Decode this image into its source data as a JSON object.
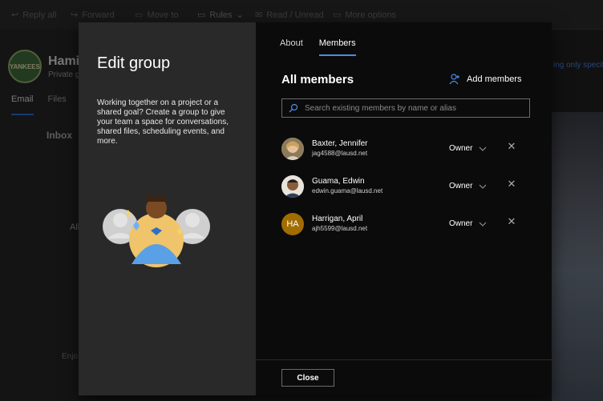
{
  "background": {
    "toolbar": {
      "reply_all": "Reply all",
      "forward": "Forward",
      "move_to": "Move to",
      "rules": "Rules",
      "read_unread": "Read / Unread",
      "more": "More options"
    },
    "group_logo_text": "YANKEES",
    "group_title": "Hamil",
    "group_sub": "Private g",
    "tab_email": "Email",
    "tab_files": "Files",
    "inbox": "Inbox",
    "all": "All",
    "enjoy": "Enjo",
    "right_text": "ing only specif"
  },
  "dialog": {
    "title": "Edit group",
    "description": "Working together on a project or a shared goal? Create a group to give your team a space for conversations, shared files, scheduling events, and more.",
    "tabs": [
      {
        "label": "About"
      },
      {
        "label": "Members"
      }
    ],
    "section_title": "All members",
    "add_members_label": "Add members",
    "search_placeholder": "Search existing members by name or alias",
    "members": [
      {
        "name": "Baxter, Jennifer",
        "email": "jag4588@lausd.net",
        "role": "Owner",
        "avatar": "photo",
        "color": "#b9a07a"
      },
      {
        "name": "Guama, Edwin",
        "email": "edwin.guama@lausd.net",
        "role": "Owner",
        "avatar": "photo",
        "color": "#6f8aa6"
      },
      {
        "name": "Harrigan, April",
        "email": "ajh5599@lausd.net",
        "role": "Owner",
        "avatar": "initials",
        "initials": "HA",
        "color": "#a16d00"
      }
    ],
    "close_label": "Close"
  },
  "colors": {
    "accent": "#4a8ce8",
    "dialog_left_bg": "#292929",
    "dialog_right_bg": "#0b0b0b"
  }
}
